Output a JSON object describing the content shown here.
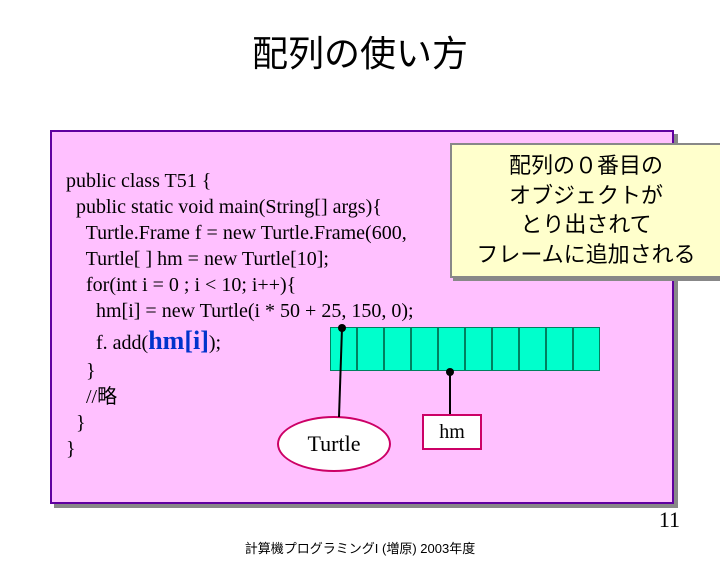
{
  "title": "配列の使い方",
  "code": {
    "line1": "public class T51 {",
    "line2": "  public static void main(String[] args){",
    "line3": "    Turtle.Frame f = new Turtle.Frame(600,",
    "line4": "    Turtle[ ] hm = new Turtle[10];",
    "line5": "    for(int i = 0 ; i < 10; i++){",
    "line6": "      hm[i] = new Turtle(i * 50 + 25, 150, 0);",
    "line7a": "      f. add(",
    "line7_hm": "hm[i]",
    "line7b": ");",
    "line8": "    }",
    "line9": "    //略",
    "line10": "  }",
    "line11": "}"
  },
  "callout": {
    "l1": "配列の０番目の",
    "l2": "オブジェクトが",
    "l3": "とり出されて",
    "l4": "フレームに追加される"
  },
  "labels": {
    "turtle": "Turtle",
    "hm": "hm"
  },
  "footer": "計算機プログラミングI (増原) 2003年度",
  "page": "11"
}
